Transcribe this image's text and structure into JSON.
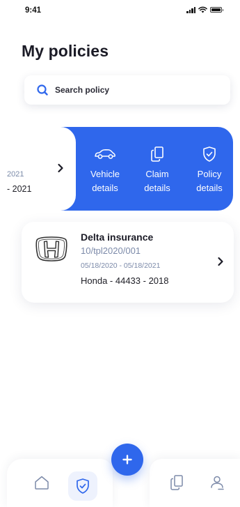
{
  "status_bar": {
    "time": "9:41"
  },
  "page": {
    "title": "My policies"
  },
  "search": {
    "placeholder": "Search policy"
  },
  "swiped_card": {
    "dates_partial": "2021",
    "vehicle_partial": "- 2021",
    "actions": [
      {
        "label": "Vehicle\ndetails",
        "icon": "car-icon"
      },
      {
        "label": "Claim\ndetails",
        "icon": "documents-icon"
      },
      {
        "label": "Policy\ndetails",
        "icon": "shield-check-icon"
      }
    ]
  },
  "policy_card": {
    "logo": "honda-logo",
    "insurer": "Delta insurance",
    "policy_number": "10/tpl2020/001",
    "dates": "05/18/2020 - 05/18/2021",
    "vehicle": "Honda - 44433 - 2018"
  },
  "nav": {
    "items": [
      "home-icon",
      "shield-check-icon",
      "documents-icon",
      "profile-icon"
    ],
    "active": "shield-check-icon",
    "fab_icon": "plus-icon"
  },
  "colors": {
    "accent": "#2f67ec",
    "text": "#1b1b26",
    "muted": "#7c8aa9"
  }
}
